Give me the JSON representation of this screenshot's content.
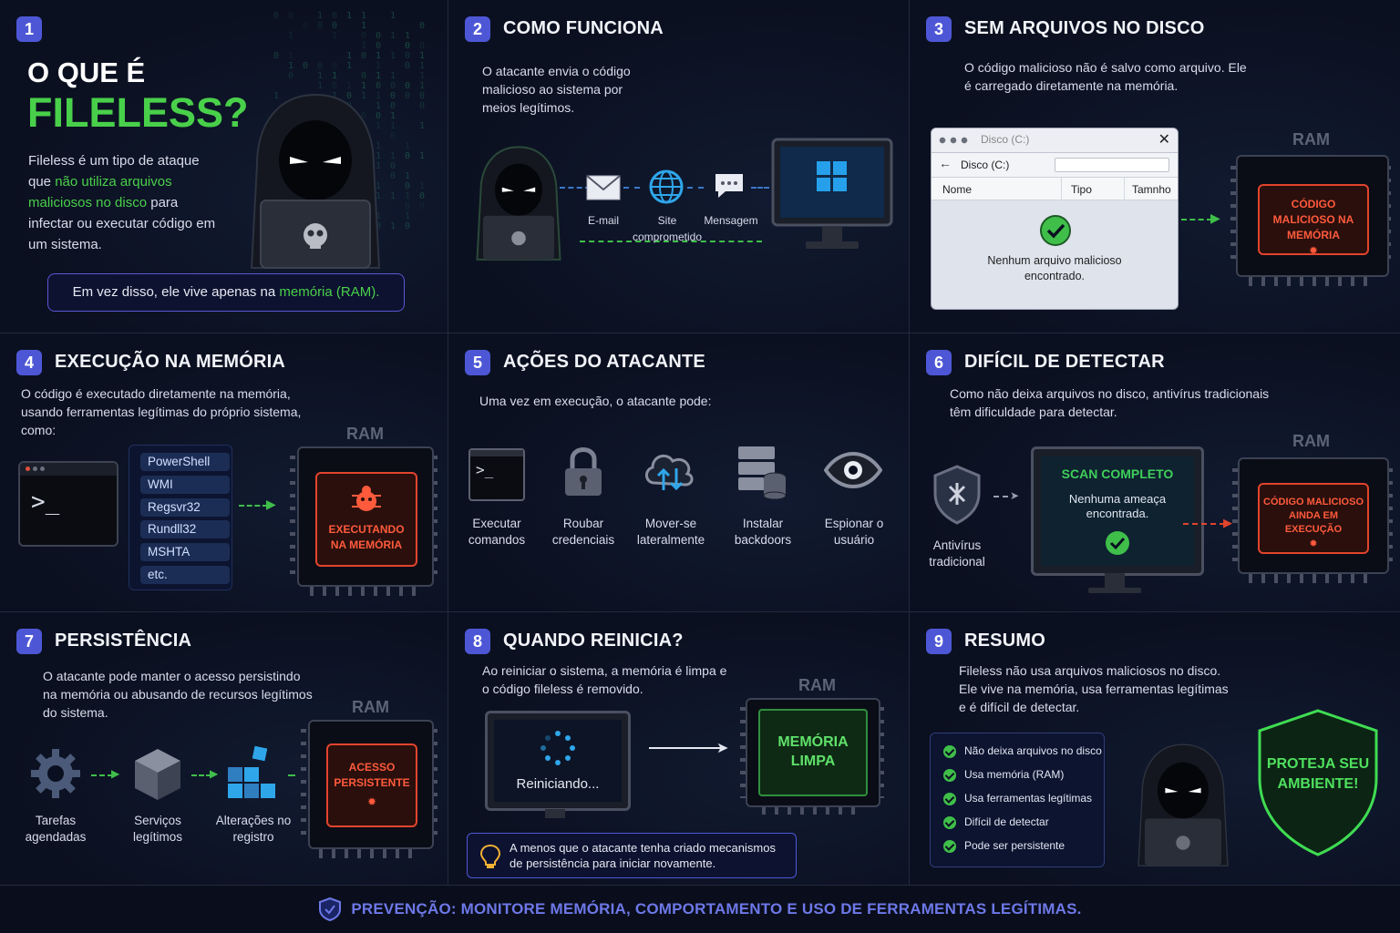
{
  "colors": {
    "accent": "#4d57d6",
    "green": "#49d04a",
    "red": "#e2442d",
    "background": "#0b1020"
  },
  "cells": {
    "c1": {
      "number": "1",
      "title_line1": "O QUE É",
      "title_line2": "FILELESS?",
      "desc_part1": "Fileless é um tipo de ataque que ",
      "desc_highlight": "não utiliza arquivos maliciosos no disco",
      "desc_part2": " para infectar ou executar código em um sistema.",
      "callout_part1": "Em vez disso, ele vive apenas na ",
      "callout_highlight": "memória (RAM).",
      "icons": [
        "hooded-hacker-icon",
        "skull-icon",
        "laptop-icon"
      ]
    },
    "c2": {
      "number": "2",
      "title": "COMO FUNCIONA",
      "desc": "O atacante envia o código malicioso ao sistema por meios legítimos.",
      "channels": [
        {
          "label": "E-mail",
          "icon": "envelope-icon"
        },
        {
          "label": "Site comprometido",
          "icon": "globe-icon"
        },
        {
          "label": "Mensagem",
          "icon": "chat-bubble-icon"
        }
      ],
      "target_icon": "windows-monitor-icon"
    },
    "c3": {
      "number": "3",
      "title": "SEM ARQUIVOS NO DISCO",
      "desc": "O código malicioso não é salvo como arquivo. Ele é carregado diretamente na memória.",
      "window_title": "Disco (C:)",
      "path": "Disco (C:)",
      "columns": [
        "Nome",
        "Tipo",
        "Tamnho"
      ],
      "message": "Nenhum arquivo malicioso encontrado.",
      "ram_label": "RAM",
      "chip_text": "CÓDIGO MALICIOSO NA MEMÓRIA"
    },
    "c4": {
      "number": "4",
      "title": "EXECUÇÃO NA MEMÓRIA",
      "desc": "O código é executado diretamente na memória, usando ferramentas legítimas do próprio sistema, como:",
      "terminal_prompt": ">_",
      "tools": [
        "PowerShell",
        "WMI",
        "Regsvr32",
        "Rundll32",
        "MSHTA",
        "etc."
      ],
      "ram_label": "RAM",
      "chip_text": "EXECUTANDO NA MEMÓRIA"
    },
    "c5": {
      "number": "5",
      "title": "AÇÕES DO ATACANTE",
      "desc": "Uma vez em execução, o atacante pode:",
      "actions": [
        {
          "label": "Executar comandos",
          "icon": "terminal-icon"
        },
        {
          "label": "Roubar credenciais",
          "icon": "padlock-icon"
        },
        {
          "label": "Mover-se lateralmente",
          "icon": "cloud-transfer-icon"
        },
        {
          "label": "Instalar backdoors",
          "icon": "server-database-icon"
        },
        {
          "label": "Espionar o usuário",
          "icon": "eye-icon"
        }
      ]
    },
    "c6": {
      "number": "6",
      "title": "DIFÍCIL DE DETECTAR",
      "desc": "Como não deixa arquivos no disco, antivírus tradicionais têm dificuldade para detectar.",
      "antivirus_label": "Antivírus tradicional",
      "scan_title": "SCAN COMPLETO",
      "scan_result": "Nenhuma ameaça encontrada.",
      "ram_label": "RAM",
      "chip_text": "CÓDIGO MALICIOSO AINDA EM EXECUÇÃO"
    },
    "c7": {
      "number": "7",
      "title": "PERSISTÊNCIA",
      "desc": "O atacante pode manter o acesso persistindo na memória ou abusando de recursos legítimos do sistema.",
      "items": [
        {
          "label": "Tarefas agendadas",
          "icon": "gear-icon"
        },
        {
          "label": "Serviços legítimos",
          "icon": "cube-icon"
        },
        {
          "label": "Alterações no registro",
          "icon": "registry-blocks-icon"
        }
      ],
      "ram_label": "RAM",
      "chip_text": "ACESSO PERSISTENTE"
    },
    "c8": {
      "number": "8",
      "title": "QUANDO REINICIA?",
      "desc": "Ao reiniciar o sistema, a memória é limpa e o código fileless é removido.",
      "restart_text": "Reiniciando...",
      "ram_label": "RAM",
      "chip_text": "MEMÓRIA LIMPA",
      "note": "A menos que o atacante tenha criado mecanismos de persistência para iniciar novamente."
    },
    "c9": {
      "number": "9",
      "title": "RESUMO",
      "desc": "Fileless não usa arquivos maliciosos no disco. Ele vive na memória, usa ferramentas legítimas e é difícil de detectar.",
      "checks": [
        "Não deixa arquivos no disco",
        "Usa memória (RAM)",
        "Usa ferramentas legítimas",
        "Difícil de detectar",
        "Pode ser persistente"
      ],
      "shield_text": "PROTEJA SEU AMBIENTE!"
    }
  },
  "footer": {
    "text": "PREVENÇÃO: MONITORE MEMÓRIA, COMPORTAMENTO E USO DE FERRAMENTAS LEGÍTIMAS.",
    "icon": "shield-icon"
  }
}
